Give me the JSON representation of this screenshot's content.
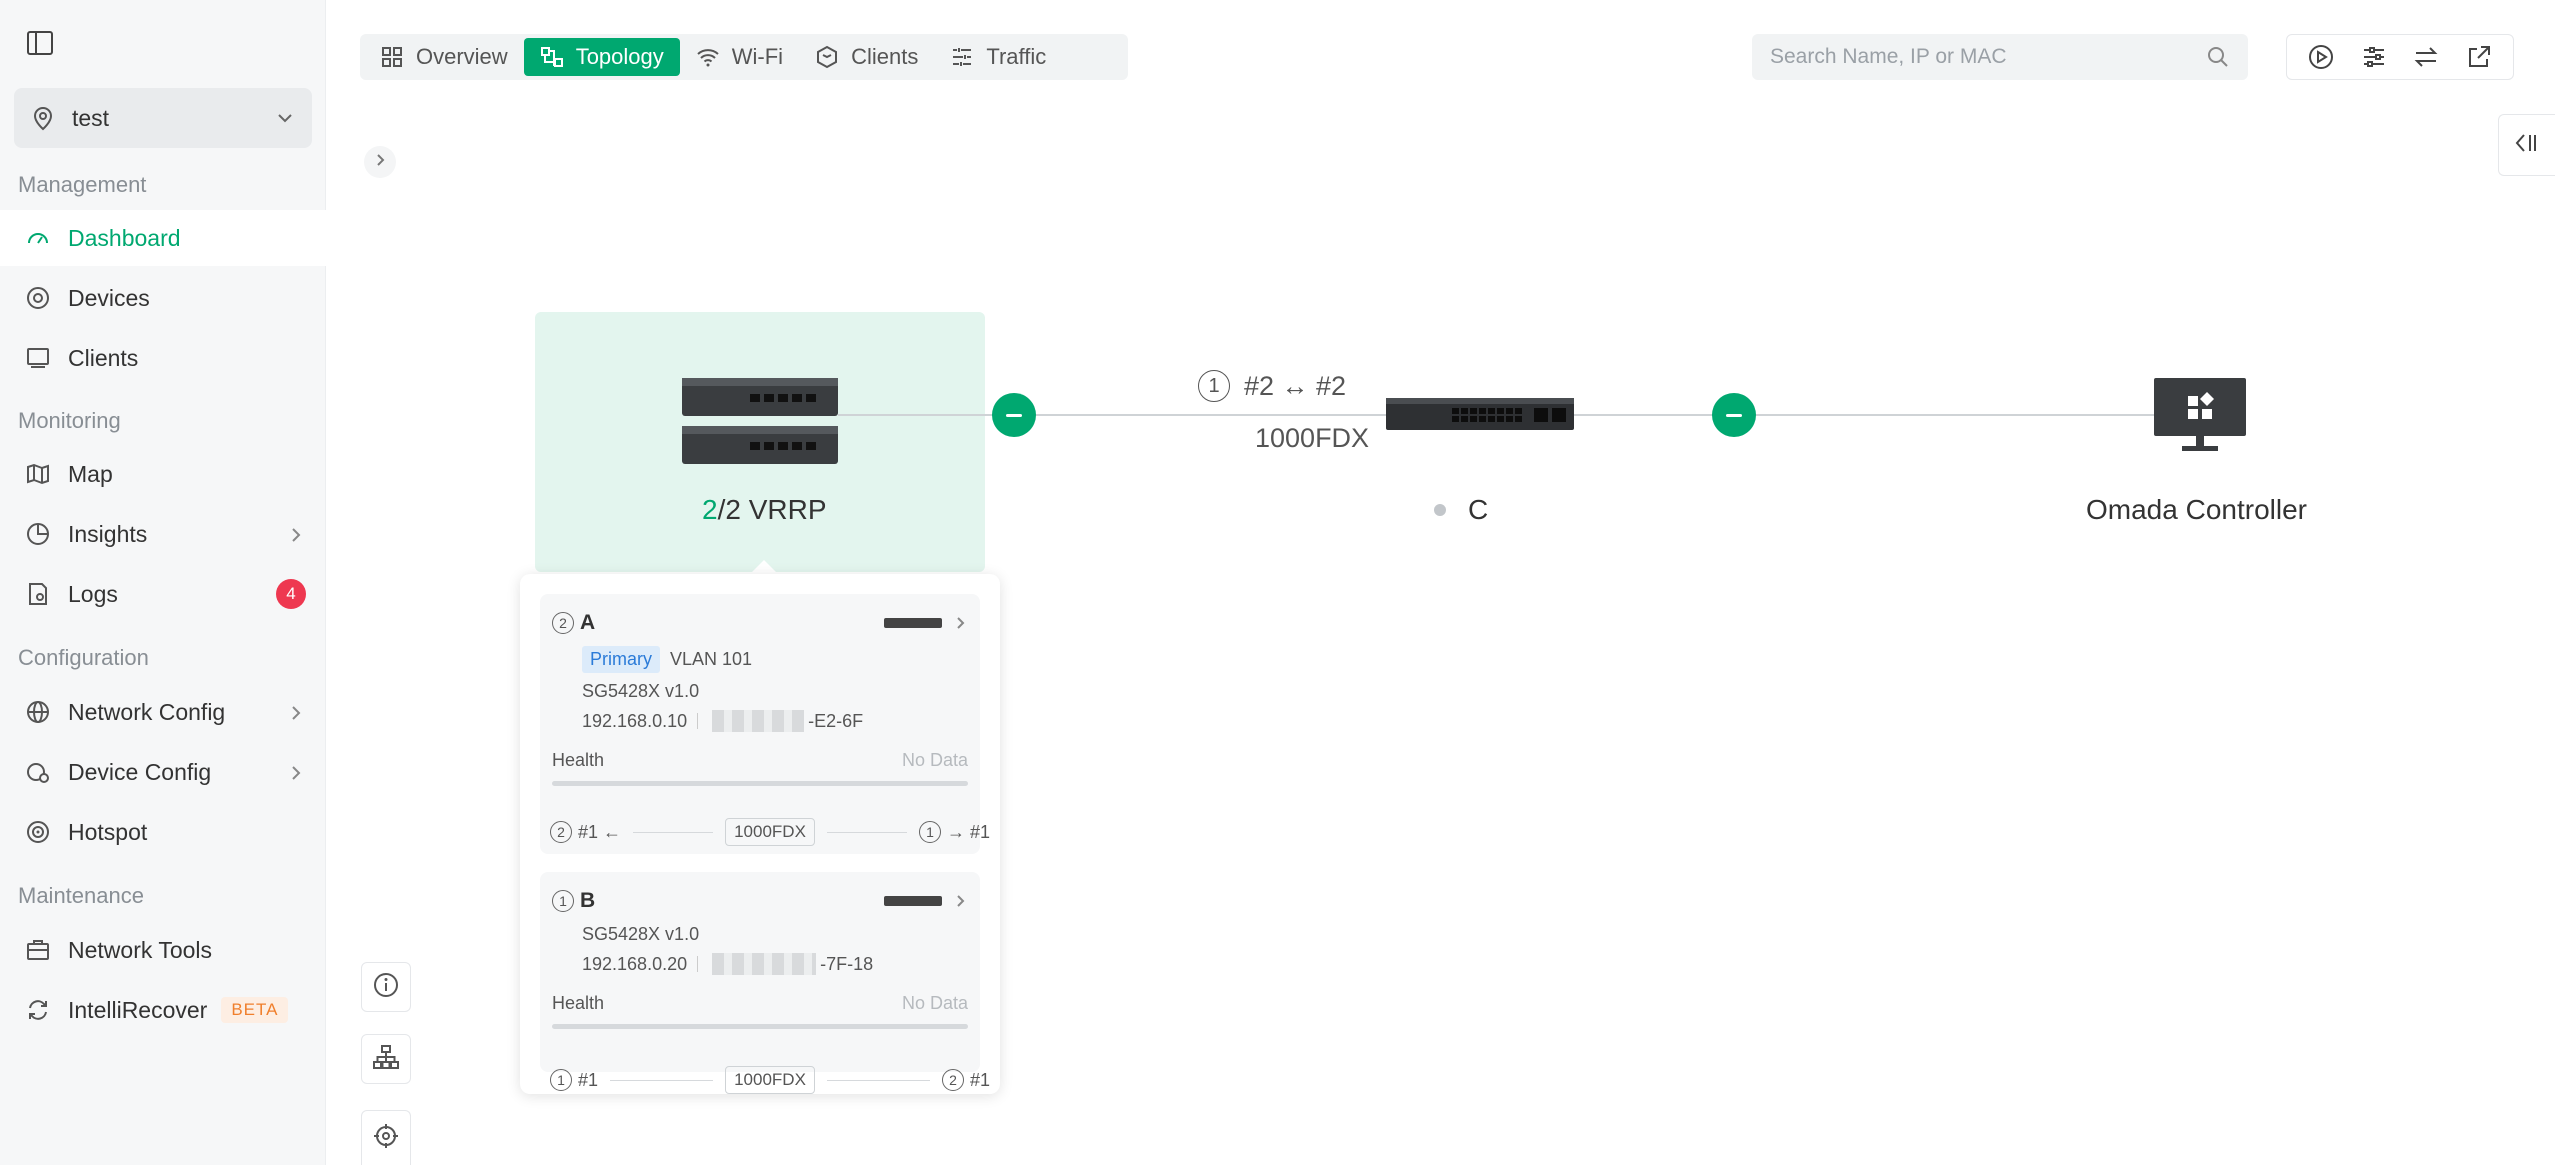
{
  "sidebar": {
    "site": "test",
    "sections": {
      "management": "Management",
      "monitoring": "Monitoring",
      "configuration": "Configuration",
      "maintenance": "Maintenance"
    },
    "items": {
      "dashboard": "Dashboard",
      "devices": "Devices",
      "clients": "Clients",
      "map": "Map",
      "insights": "Insights",
      "logs": "Logs",
      "logs_badge": "4",
      "network_config": "Network Config",
      "device_config": "Device Config",
      "hotspot": "Hotspot",
      "network_tools": "Network Tools",
      "intellirecover": "IntelliRecover",
      "beta": "BETA"
    }
  },
  "tabs": [
    "Overview",
    "Topology",
    "Wi-Fi",
    "Clients",
    "Traffic"
  ],
  "search": {
    "placeholder": "Search Name, IP or MAC"
  },
  "topology": {
    "vrrp": {
      "active": "2",
      "rest": "/2 VRRP"
    },
    "link1": {
      "port_num": "1",
      "ports": "#2 ↔ #2",
      "speed": "1000FDX"
    },
    "switch_c": {
      "name": "C",
      "status": "offline"
    },
    "controller": {
      "name": "Omada Controller"
    }
  },
  "popup": {
    "devices": [
      {
        "num": "2",
        "name": "A",
        "role": "Primary",
        "vlan": "VLAN 101",
        "model": "SG5428X v1.0",
        "ip": "192.168.0.10",
        "mac_suffix": "-E2-6F",
        "health_label": "Health",
        "health_value": "No Data",
        "port_left_num": "2",
        "port_left": "#1 ←",
        "speed": "1000FDX",
        "port_right_num": "1",
        "port_right": "→ #1"
      },
      {
        "num": "1",
        "name": "B",
        "model": "SG5428X v1.0",
        "ip": "192.168.0.20",
        "mac_suffix": "-7F-18",
        "health_label": "Health",
        "health_value": "No Data",
        "port_left_num": "1",
        "port_left": "#1",
        "speed": "1000FDX",
        "port_right_num": "2",
        "port_right": "#1"
      }
    ]
  },
  "colors": {
    "accent": "#00a870",
    "badge": "#ee3850",
    "vrrp_bg": "#e3f5ee"
  }
}
